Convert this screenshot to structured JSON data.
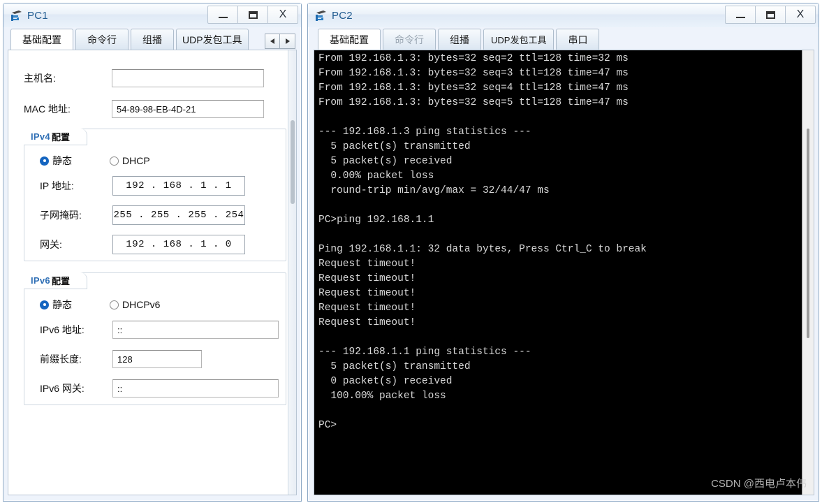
{
  "pc1": {
    "title": "PC1",
    "icon": "pc-terminal-icon",
    "controls": {
      "minimize": "_",
      "maximize": "❐",
      "close": "X"
    },
    "tabs": [
      {
        "label": "基础配置",
        "active": true
      },
      {
        "label": "命令行",
        "active": false
      },
      {
        "label": "组播",
        "active": false
      },
      {
        "label": "UDP发包工具",
        "active": false
      }
    ],
    "scroll_left": "◀",
    "scroll_right": "▶",
    "form": {
      "hostname_label": "主机名:",
      "hostname_value": "",
      "mac_label": "MAC 地址:",
      "mac_value": "54-89-98-EB-4D-21"
    },
    "ipv4": {
      "group_prefix": "IPv4",
      "group_suffix": "配置",
      "static_label": "静态",
      "dhcp_label": "DHCP",
      "static_selected": true,
      "ip_label": "IP 地址:",
      "ip_value": "192 . 168 .  1  .  1",
      "mask_label": "子网掩码:",
      "mask_value": "255 . 255 . 255 . 254",
      "gateway_label": "网关:",
      "gateway_value": "192 . 168 .  1  .  0"
    },
    "ipv6": {
      "group_prefix": "IPv6",
      "group_suffix": "配置",
      "static_label": "静态",
      "dhcp_label": "DHCPv6",
      "static_selected": true,
      "addr_label": "IPv6 地址:",
      "addr_value": "::",
      "prefix_label": "前缀长度:",
      "prefix_value": "128",
      "gateway_label": "IPv6 网关:",
      "gateway_value": "::"
    }
  },
  "pc2": {
    "title": "PC2",
    "icon": "pc-terminal-icon",
    "controls": {
      "minimize": "_",
      "maximize": "❐",
      "close": "X"
    },
    "tabs": [
      {
        "label": "基础配置",
        "active": true
      },
      {
        "label": "命令行",
        "active": false,
        "dim": true
      },
      {
        "label": "组播",
        "active": false
      },
      {
        "label": "UDP发包工具",
        "active": false
      },
      {
        "label": "串口",
        "active": false
      }
    ],
    "terminal_text": "From 192.168.1.3: bytes=32 seq=2 ttl=128 time=32 ms\nFrom 192.168.1.3: bytes=32 seq=3 ttl=128 time=47 ms\nFrom 192.168.1.3: bytes=32 seq=4 ttl=128 time=47 ms\nFrom 192.168.1.3: bytes=32 seq=5 ttl=128 time=47 ms\n\n--- 192.168.1.3 ping statistics ---\n  5 packet(s) transmitted\n  5 packet(s) received\n  0.00% packet loss\n  round-trip min/avg/max = 32/44/47 ms\n\nPC>ping 192.168.1.1\n\nPing 192.168.1.1: 32 data bytes, Press Ctrl_C to break\nRequest timeout!\nRequest timeout!\nRequest timeout!\nRequest timeout!\nRequest timeout!\n\n--- 192.168.1.1 ping statistics ---\n  5 packet(s) transmitted\n  0 packet(s) received\n  100.00% packet loss\n\nPC>",
    "watermark": "CSDN @西电卢本伟"
  }
}
